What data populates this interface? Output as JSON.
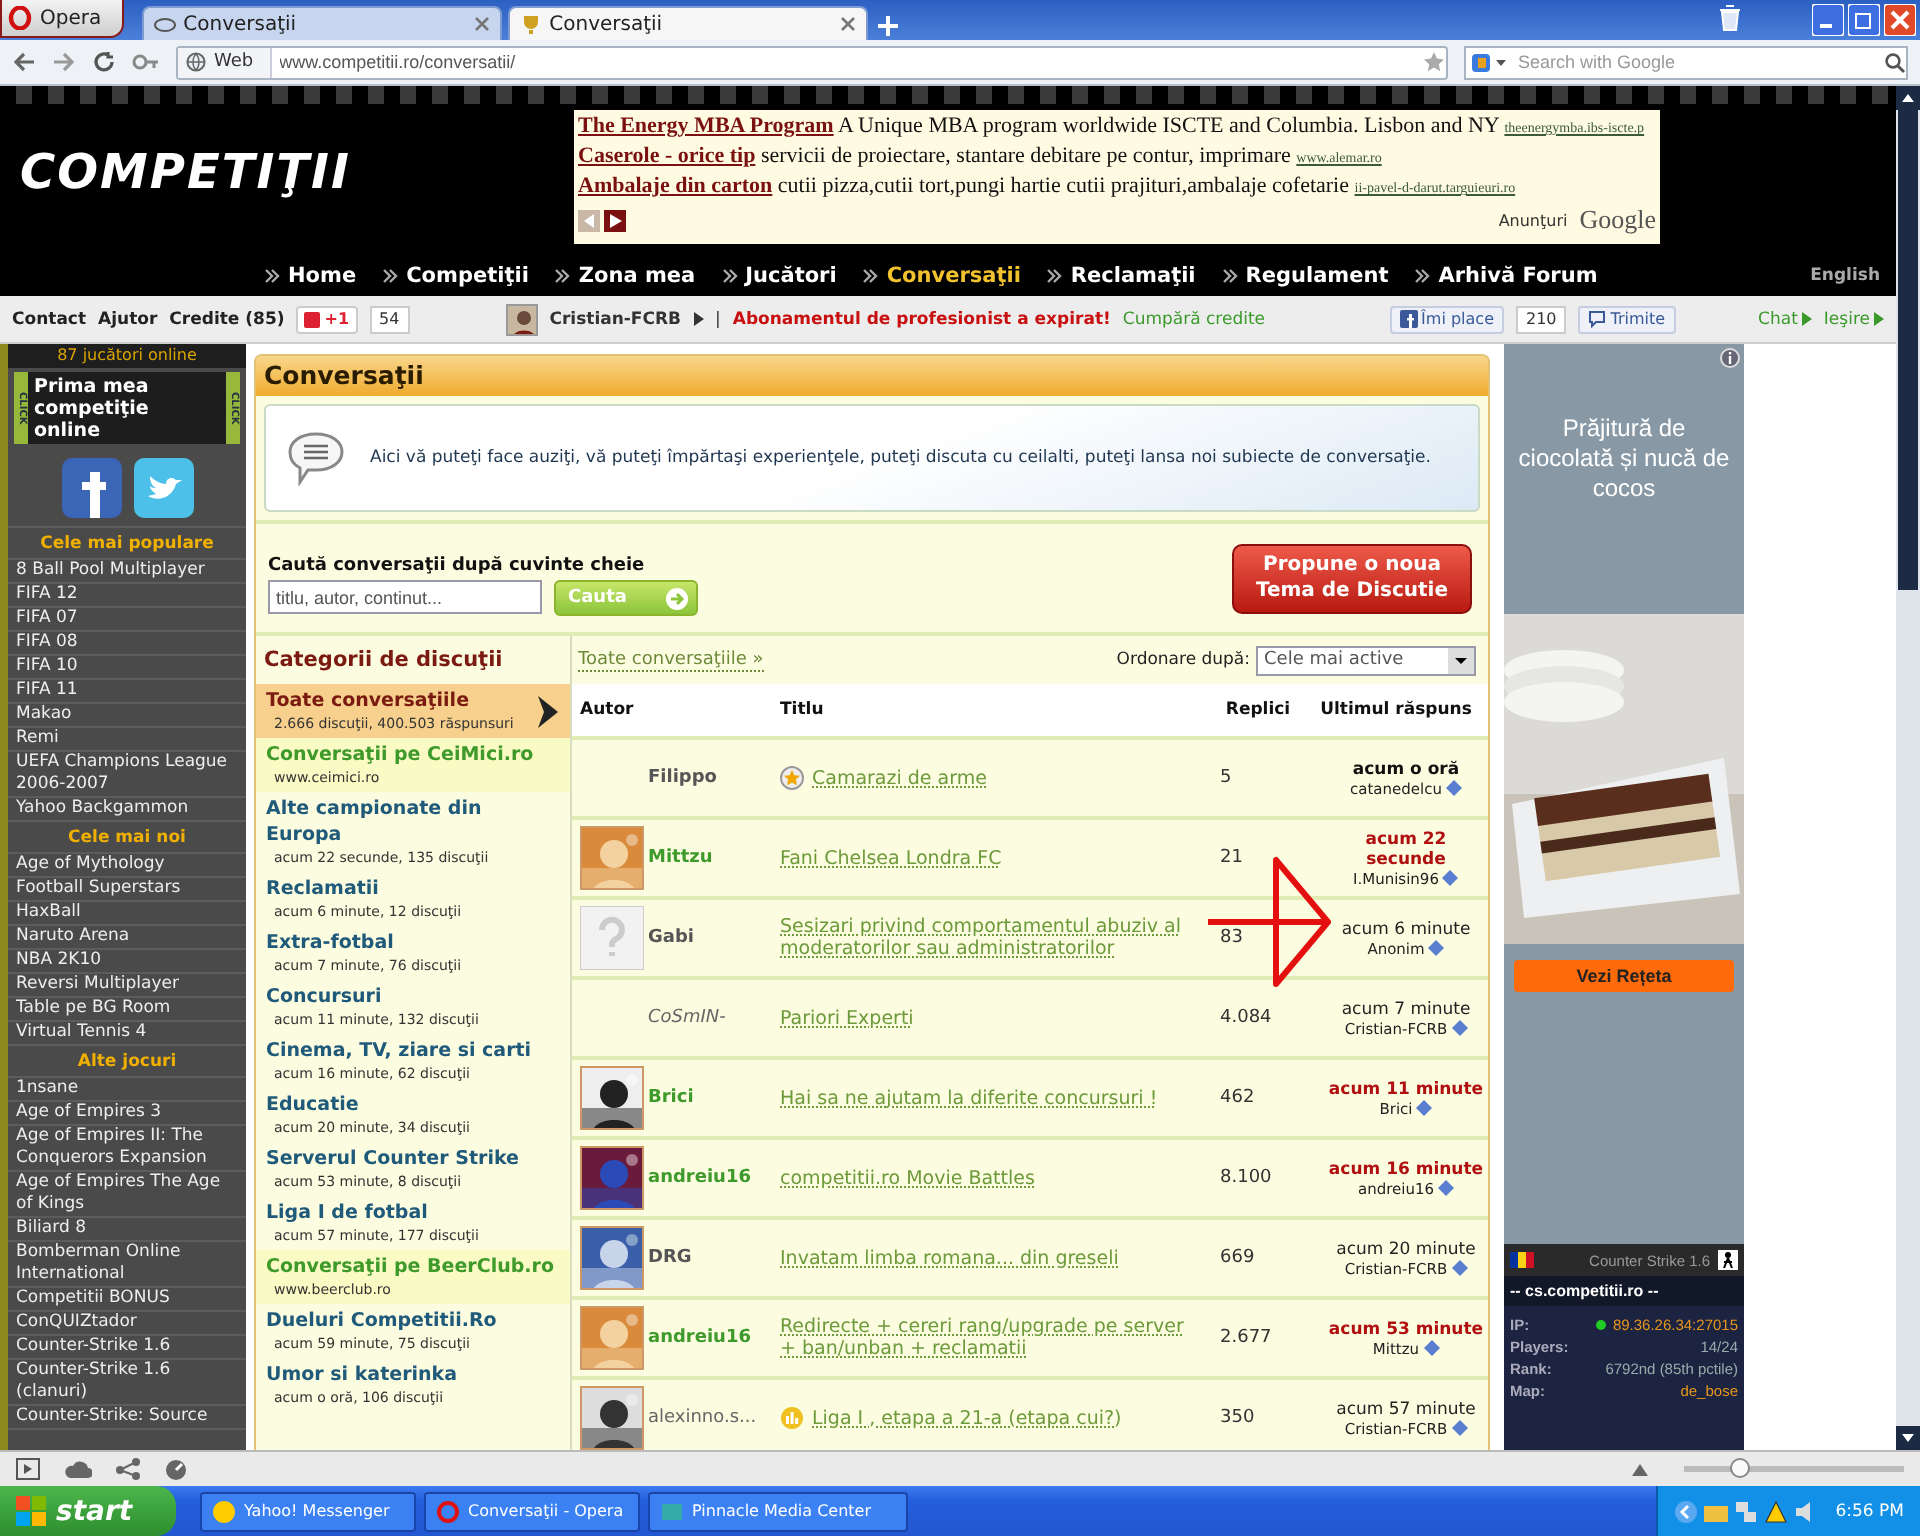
{
  "browser": {
    "menu": "Opera",
    "tabs": [
      {
        "title": "Conversaţii",
        "selected": false
      },
      {
        "title": "Conversaţii",
        "selected": true
      }
    ],
    "address_label": "Web",
    "url": "www.competitii.ro/conversatii/",
    "search_placeholder": "Search with Google"
  },
  "header": {
    "logo": "COMPETIŢII",
    "ads": [
      {
        "title": "The Energy MBA Program",
        "text": "A Unique MBA program worldwide ISCTE and Columbia. Lisbon and NY",
        "url": "theenergymba.ibs-iscte.p"
      },
      {
        "title": "Caserole - orice tip",
        "text": "servicii de proiectare, stantare debitare pe contur, imprimare",
        "url": "www.alemar.ro"
      },
      {
        "title": "Ambalaje din carton",
        "text": "cutii pizza,cutii tort,pungi hartie cutii prajituri,ambalaje cofetarie",
        "url": "ii-pavel-d-darut.targuieuri.ro"
      }
    ],
    "ads_label": "Anunţuri",
    "ads_brand": "Google"
  },
  "nav": {
    "items": [
      {
        "label": "Home",
        "selected": false
      },
      {
        "label": "Competiţii",
        "selected": false
      },
      {
        "label": "Zona mea",
        "selected": false
      },
      {
        "label": "Jucători",
        "selected": false
      },
      {
        "label": "Conversaţii",
        "selected": true
      },
      {
        "label": "Reclamaţii",
        "selected": false
      },
      {
        "label": "Regulament",
        "selected": false
      },
      {
        "label": "Arhivă Forum",
        "selected": false
      }
    ],
    "language": "English"
  },
  "userbar": {
    "links": [
      "Contact",
      "Ajutor",
      "Credite (85)"
    ],
    "plus_one": "+1",
    "plus_count": "54",
    "user": "Cristian-FCRB",
    "separator": "|",
    "alert": "Abonamentul de profesionist a expirat!",
    "buy_link": "Cumpără credite",
    "like": "Îmi place",
    "like_count": "210",
    "send": "Trimite",
    "chat": "Chat",
    "logout": "Ieşire"
  },
  "sidebar": {
    "online": "87 jucători online",
    "banner": {
      "title": "Prima mea competiţie online",
      "tags": [
        "CLICK",
        "CLICK"
      ]
    },
    "sections": [
      {
        "title": "Cele mai populare",
        "games": [
          "8 Ball Pool Multiplayer",
          "FIFA 12",
          "FIFA 07",
          "FIFA 08",
          "FIFA 10",
          "FIFA 11",
          "Makao",
          "Remi",
          "UEFA Champions League 2006-2007",
          "Yahoo Backgammon"
        ]
      },
      {
        "title": "Cele mai noi",
        "games": [
          "Age of Mythology",
          "Football Superstars",
          "HaxBall",
          "Naruto Arena",
          "NBA 2K10",
          "Reversi Multiplayer",
          "Table pe BG Room",
          "Virtual Tennis 4"
        ]
      },
      {
        "title": "Alte jocuri",
        "games": [
          "1nsane",
          "Age of Empires 3",
          "Age of Empires II: The Conquerors Expansion",
          "Age of Empires The Age of Kings",
          "Biliard 8",
          "Bomberman Online International",
          "Competitii BONUS",
          "ConQUIZtador",
          "Counter-Strike 1.6",
          "Counter-Strike 1.6 (clanuri)",
          "Counter-Strike: Source"
        ]
      }
    ]
  },
  "page": {
    "title": "Conversaţii",
    "intro": "Aici vă puteţi face auziţi, vă puteţi împărtaşi experienţele, puteţi discuta cu ceilalti, puteţi lansa noi subiecte de conversaţie.",
    "search": {
      "label": "Caută conversaţii după cuvinte cheie",
      "placeholder": "titlu, autor, continut...",
      "button": "Cauta"
    },
    "propose_button": "Propune o noua Tema de Discutie"
  },
  "categories": {
    "title": "Categorii de discuţii",
    "items": [
      {
        "kind": "category",
        "name": "Toate conversaţiile",
        "info": "2.666 discuţii, 400.503 răspunsuri",
        "selected": true
      },
      {
        "kind": "sponsored",
        "name": "Conversaţii pe CeiMici.ro",
        "info": "www.ceimici.ro",
        "selected": false
      },
      {
        "kind": "category",
        "name": "Alte campionate din Europa",
        "info": "acum 22 secunde, 135 discuţii",
        "selected": false
      },
      {
        "kind": "category",
        "name": "Reclamatii",
        "info": "acum 6 minute, 12 discuţii",
        "selected": false
      },
      {
        "kind": "category",
        "name": "Extra-fotbal",
        "info": "acum 7 minute, 76 discuţii",
        "selected": false
      },
      {
        "kind": "category",
        "name": "Concursuri",
        "info": "acum 11 minute, 132 discuţii",
        "selected": false
      },
      {
        "kind": "category",
        "name": "Cinema, TV, ziare si carti",
        "info": "acum 16 minute, 62 discuţii",
        "selected": false
      },
      {
        "kind": "category",
        "name": "Educatie",
        "info": "acum 20 minute, 34 discuţii",
        "selected": false
      },
      {
        "kind": "category",
        "name": "Serverul Counter Strike",
        "info": "acum 53 minute, 8 discuţii",
        "selected": false
      },
      {
        "kind": "category",
        "name": "Liga I de fotbal",
        "info": "acum 57 minute, 177 discuţii",
        "selected": false
      },
      {
        "kind": "sponsored",
        "name": "Conversaţii pe BeerClub.ro",
        "info": "www.beerclub.ro",
        "selected": false
      },
      {
        "kind": "category",
        "name": "Dueluri Competitii.Ro",
        "info": "acum 59 minute, 75 discuţii",
        "selected": false
      },
      {
        "kind": "category",
        "name": "Umor si katerinka",
        "info": "acum o oră, 106 discuţii",
        "selected": false
      }
    ]
  },
  "table": {
    "all_link": "Toate conversaţiile »",
    "sort_label": "Ordonare după:",
    "sort_value": "Cele mai active",
    "columns": [
      "Autor",
      "Titlu",
      "Replici",
      "Ultimul răspuns"
    ],
    "annotation": {
      "kind": "arrow"
    },
    "rows": [
      {
        "author": {
          "name": "Filippo",
          "kind": "bold"
        },
        "topic": {
          "title": "Camarazi de arme",
          "icon": {
            "kind": "star"
          }
        },
        "replies": "5",
        "last": {
          "time": "acum o oră",
          "user": "catanedelcu",
          "kind": "strong"
        }
      },
      {
        "author": {
          "name": "Mittzu",
          "kind": "highlighted"
        },
        "topic": {
          "title": "Fani Chelsea Londra FC"
        },
        "replies": "21",
        "last": {
          "time": "acum 22 secunde",
          "user": "I.Munisin96",
          "kind": "recent"
        }
      },
      {
        "avatar": {
          "kind": "placeholder"
        },
        "author": {
          "name": "Gabi",
          "kind": "bold"
        },
        "topic": {
          "title": "Sesizari privind comportamentul abuziv al moderatorilor sau administratorilor"
        },
        "replies": "83",
        "last": {
          "time": "acum 6 minute",
          "user": "Anonim",
          "kind": "plain"
        }
      },
      {
        "author": {
          "name": "CoSmIN-",
          "kind": "italic"
        },
        "topic": {
          "title": "Pariori Experti"
        },
        "replies": "4.084",
        "last": {
          "time": "acum 7 minute",
          "user": "Cristian-FCRB",
          "kind": "plain"
        }
      },
      {
        "author": {
          "name": "Brici",
          "kind": "highlighted"
        },
        "topic": {
          "title": "Hai sa ne ajutam la diferite concursuri !"
        },
        "replies": "462",
        "last": {
          "time": "acum 11 minute",
          "user": "Brici",
          "kind": "recent"
        }
      },
      {
        "author": {
          "name": "andreiu16",
          "kind": "highlighted"
        },
        "topic": {
          "title": "competitii.ro Movie Battles"
        },
        "replies": "8.100",
        "last": {
          "time": "acum 16 minute",
          "user": "andreiu16",
          "kind": "recent"
        }
      },
      {
        "author": {
          "name": "DRG",
          "kind": "bold"
        },
        "topic": {
          "title": "Invatam limba romana... din greseli"
        },
        "replies": "669",
        "last": {
          "time": "acum 20 minute",
          "user": "Cristian-FCRB",
          "kind": "plain"
        }
      },
      {
        "author": {
          "name": "andreiu16",
          "kind": "highlighted"
        },
        "topic": {
          "title": "Redirecte + cereri rang/upgrade pe server + ban/unban + reclamatii"
        },
        "replies": "2.677",
        "last": {
          "time": "acum 53 minute",
          "user": "Mittzu",
          "kind": "recent"
        }
      },
      {
        "author": {
          "name": "alexinno.s...",
          "kind": "plain"
        },
        "topic": {
          "title": "Liga I , etapa a 21-a (etapa cui?)",
          "icon": {
            "kind": "poll"
          }
        },
        "replies": "350",
        "last": {
          "time": "acum 57 minute",
          "user": "Cristian-FCRB",
          "kind": "plain"
        }
      }
    ]
  },
  "ad": {
    "title": "Prăjitură de ciocolată și nucă de cocos",
    "button": "Vezi Rețeta"
  },
  "server": {
    "game": "Counter Strike 1.6",
    "name": "-- cs.competitii.ro --",
    "fields": [
      {
        "label": "IP:",
        "value": "89.36.26.34:27015",
        "online": true,
        "accent": true
      },
      {
        "label": "Players:",
        "value": "14/24",
        "online": false,
        "accent": false
      },
      {
        "label": "Rank:",
        "value": "6792nd (85th pctile)",
        "online": false,
        "accent": false
      },
      {
        "label": "Map:",
        "value": "de_bose",
        "online": false,
        "accent": true
      }
    ]
  },
  "status_bar": {
    "zoom": {
      "level": 0.25
    }
  },
  "taskbar": {
    "start": "start",
    "tasks": [
      {
        "label": "Yahoo! Messenger",
        "selected": false
      },
      {
        "label": "Conversaţii - Opera",
        "selected": false
      },
      {
        "label": "Pinnacle Media Center",
        "selected": false
      }
    ],
    "clock": "6:56 PM"
  }
}
